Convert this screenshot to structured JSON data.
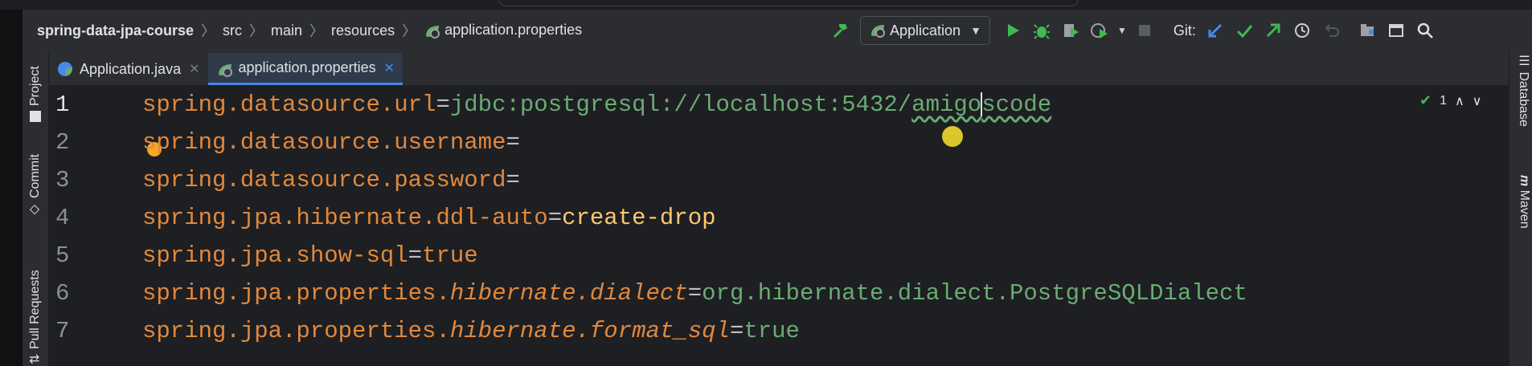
{
  "breadcrumbs": [
    "spring-data-jpa-course",
    "src",
    "main",
    "resources",
    "application.properties"
  ],
  "run_config": {
    "label": "Application"
  },
  "git": {
    "label": "Git:"
  },
  "tabs": [
    {
      "label": "Application.java",
      "active": false
    },
    {
      "label": "application.properties",
      "active": true
    }
  ],
  "left_tool_windows": [
    "Project",
    "Commit",
    "Pull Requests"
  ],
  "right_tool_windows": [
    "Database",
    "Maven"
  ],
  "inspection": {
    "count": "1"
  },
  "editor": {
    "lines": [
      {
        "num": "1",
        "key": "spring.datasource.url",
        "eq": "=",
        "value_a": "jdbc:postgresql://localhost:5432/",
        "value_b": "amigo",
        "value_c": "scode"
      },
      {
        "num": "2",
        "key": "spring.datasource.username",
        "eq": "="
      },
      {
        "num": "3",
        "key": "spring.datasource.password",
        "eq": "="
      },
      {
        "num": "4",
        "key": "spring.jpa.hibernate.ddl-auto",
        "eq": "=",
        "value": "create-drop"
      },
      {
        "num": "5",
        "key": "spring.jpa.show-sql",
        "eq": "=",
        "value": "true"
      },
      {
        "num": "6",
        "key_a": "spring.jpa.properties.",
        "key_b": "hibernate.dialect",
        "eq": "=",
        "value": "org.hibernate.dialect.PostgreSQLDialect"
      },
      {
        "num": "7",
        "key_a": "spring.jpa.properties.",
        "key_b": "hibernate.format_sql",
        "eq": "=",
        "value": "true"
      }
    ]
  },
  "colors": {
    "accent": "#4a88e8",
    "run_green": "#3fb950",
    "key_orange": "#e0883e",
    "value_green": "#6aab73"
  }
}
